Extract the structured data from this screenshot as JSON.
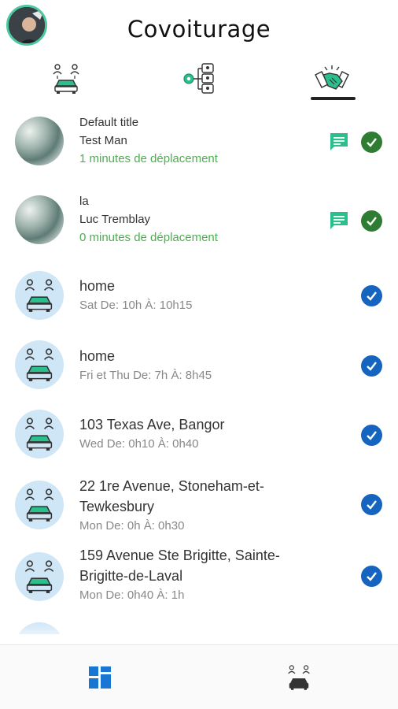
{
  "header": {
    "title": "Covoiturage",
    "avatar_icon": "user-avatar"
  },
  "tabs": [
    {
      "name": "carpool-tab",
      "icon": "carpool-icon",
      "active": false
    },
    {
      "name": "settings-tab",
      "icon": "settings-flow-icon",
      "active": false
    },
    {
      "name": "matches-tab",
      "icon": "handshake-icon",
      "active": true
    }
  ],
  "matches": [
    {
      "title": "Default title",
      "name": "Test Man",
      "duration": "1 minutes de déplacement",
      "status": "confirmed"
    },
    {
      "title": "la",
      "name": "Luc Tremblay",
      "duration": "0 minutes de déplacement",
      "status": "confirmed"
    }
  ],
  "trips": [
    {
      "address": "home",
      "schedule": "Sat De:  10h À:  10h15"
    },
    {
      "address": "home",
      "schedule": "Fri et Thu De:  7h À:  8h45"
    },
    {
      "address": "103 Texas Ave, Bangor",
      "schedule": "Wed De:  0h10 À:  0h40"
    },
    {
      "address_line1": "22 1re Avenue, Stoneham-et-",
      "address_line2": "Tewkesbury",
      "schedule": "Mon De:  0h À:  0h30"
    },
    {
      "address_line1": "159 Avenue Ste Brigitte, Sainte-",
      "address_line2": "Brigitte-de-Laval",
      "schedule": "Mon De:  0h40 À:  1h"
    }
  ],
  "bottom_nav": [
    {
      "name": "dashboard",
      "icon": "dashboard-icon"
    },
    {
      "name": "carpool",
      "icon": "carpool-icon"
    }
  ],
  "colors": {
    "accent_green": "#4caf50",
    "check_green": "#2e7d32",
    "check_blue": "#1565c0",
    "chat_teal": "#2bbf8e",
    "avatar_bg": "#cfe6f7"
  }
}
